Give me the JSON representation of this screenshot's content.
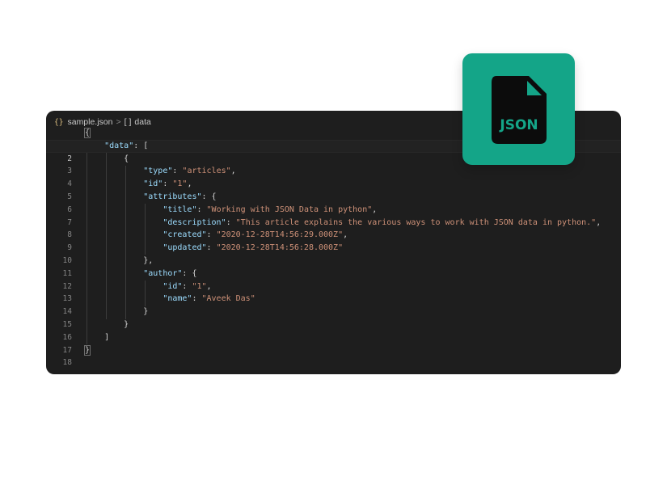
{
  "breadcrumb": {
    "file_icon": "{}",
    "file_name": "sample.json",
    "separator": ">",
    "node_icon": "[ ]",
    "node_name": "data"
  },
  "logo": {
    "text": "JSON",
    "icon": "json-file-icon",
    "color": "#14a588"
  },
  "code_lines": [
    {
      "n": "1"
    },
    {
      "n": "2"
    },
    {
      "n": "3"
    },
    {
      "n": "4"
    },
    {
      "n": "5"
    },
    {
      "n": "6"
    },
    {
      "n": "7"
    },
    {
      "n": "8"
    },
    {
      "n": "9"
    },
    {
      "n": "10"
    },
    {
      "n": "11"
    },
    {
      "n": "12"
    },
    {
      "n": "13"
    },
    {
      "n": "14"
    },
    {
      "n": "15"
    },
    {
      "n": "16"
    },
    {
      "n": "17"
    },
    {
      "n": "18"
    }
  ],
  "code": {
    "l1_open": "{",
    "data_key": "\"data\"",
    "data_punct": ": [",
    "l3": "{",
    "type_key": "\"type\"",
    "type_val": "\"articles\"",
    "id_key": "\"id\"",
    "id_val": "\"1\"",
    "attributes_key": "\"attributes\"",
    "attributes_punct": ": {",
    "title_key": "\"title\"",
    "title_val": "\"Working with JSON Data in python\"",
    "description_key": "\"description\"",
    "description_val": "\"This article explains the various ways to work with JSON data in python.\"",
    "created_key": "\"created\"",
    "created_val": "\"2020-12-28T14:56:29.000Z\"",
    "updated_key": "\"updated\"",
    "updated_val": "\"2020-12-28T14:56:28.000Z\"",
    "l11": "},",
    "author_key": "\"author\"",
    "author_punct": ": {",
    "author_id_key": "\"id\"",
    "author_id_val": "\"1\"",
    "name_key": "\"name\"",
    "name_val": "\"Aveek Das\"",
    "l15": "}",
    "l16": "}",
    "l17": "]",
    "l18": "}"
  }
}
